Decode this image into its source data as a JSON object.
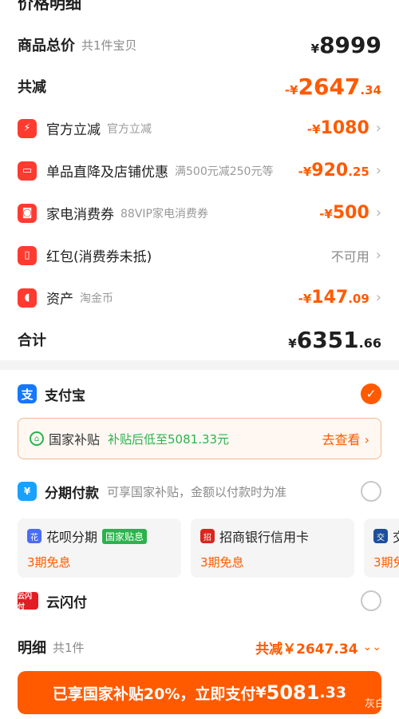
{
  "header": {
    "title": "价格明细"
  },
  "summary": {
    "total_label": "商品总价",
    "total_sub": "共1件宝贝",
    "total_yen": "¥",
    "total_int": "8999",
    "minus_label": "共减",
    "minus_prefix": "-¥",
    "minus_int": "2647",
    "minus_dec": ".34"
  },
  "discounts": [
    {
      "icon": "bolt-icon",
      "glyph": "⚡",
      "label": "官方立减",
      "sub": "官方立减",
      "amount_prefix": "-¥",
      "amount_int": "1080",
      "amount_dec": ""
    },
    {
      "icon": "store-icon",
      "glyph": "▭",
      "label": "单品直降及店铺优惠",
      "sub": "满500元减250元等",
      "amount_prefix": "-¥",
      "amount_int": "920",
      "amount_dec": ".25"
    },
    {
      "icon": "coupon-icon",
      "glyph": "◙",
      "label": "家电消费券",
      "sub": "88VIP家电消费券",
      "amount_prefix": "-¥",
      "amount_int": "500",
      "amount_dec": ""
    },
    {
      "icon": "red-packet-icon",
      "glyph": "▯",
      "label": "红包(消费券未抵)",
      "sub": "",
      "na": "不可用"
    },
    {
      "icon": "coin-icon",
      "glyph": "◖",
      "label": "资产",
      "sub": "淘金币",
      "amount_prefix": "-¥",
      "amount_int": "147",
      "amount_dec": ".09"
    }
  ],
  "sum": {
    "label": "合计",
    "yen": "¥",
    "int": "6351",
    "dec": ".66"
  },
  "payment": {
    "alipay": {
      "label": "支付宝",
      "glyph": "支"
    },
    "subsidy": {
      "label": "国家补贴",
      "desc": "补贴后低至5081.33元",
      "action": "去查看 ›"
    },
    "installment": {
      "label": "分期付款",
      "desc": "可享国家补贴，金额以付款时为准",
      "glyph": "¥"
    },
    "cards": [
      {
        "label": "花呗分期",
        "badge": "国家贴息",
        "sub": "3期免息",
        "color": "#4a6cf7",
        "glyph": "花"
      },
      {
        "label": "招商银行信用卡",
        "badge": "",
        "sub": "3期免息",
        "color": "#d8261e",
        "glyph": "招"
      },
      {
        "label": "交",
        "badge": "",
        "sub": "3期免",
        "color": "#1c4e9c",
        "glyph": "交"
      }
    ],
    "unionpay": {
      "label": "云闪付",
      "glyph": "云闪付"
    }
  },
  "detail": {
    "label": "明细",
    "count": "共1件",
    "total": "共减￥2647.34",
    "chevron": "⌄⌄"
  },
  "pay_button": {
    "text": "已享国家补贴20%，立即支付",
    "amount_yen": "¥",
    "amount_int": "5081",
    "amount_dec": ".33"
  },
  "watermark": "灰白呀",
  "colors": {
    "accent": "#ff5a00",
    "green": "#2bb24c",
    "alipay": "#1677ff",
    "red_icon": "#ff3b30"
  }
}
